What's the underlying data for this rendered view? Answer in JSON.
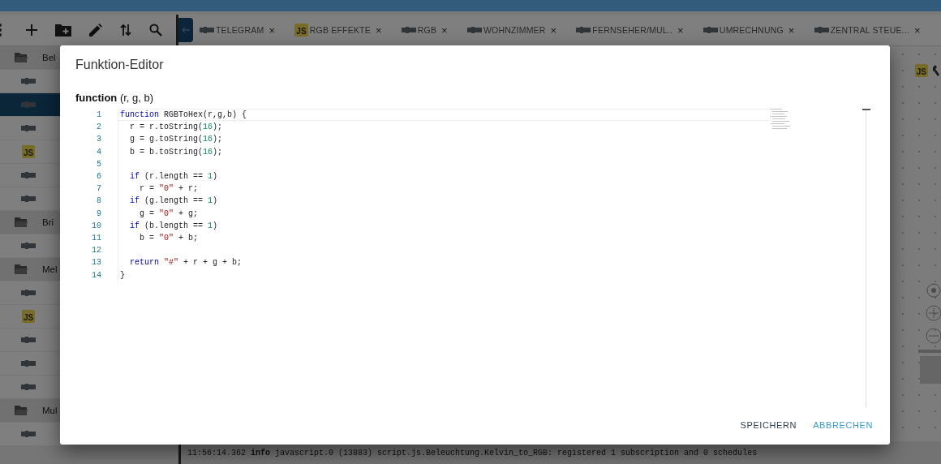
{
  "toolbar": {
    "buttons": [
      {
        "kind": "menu"
      },
      {
        "kind": "add"
      },
      {
        "kind": "new-folder"
      },
      {
        "kind": "edit"
      },
      {
        "kind": "sort"
      },
      {
        "kind": "search"
      }
    ]
  },
  "tabs": [
    {
      "kind": "script",
      "label": "TELEGRAM",
      "close": "×"
    },
    {
      "kind": "js",
      "badge": "JS",
      "label": "RGB EFFEKTE",
      "close": "×"
    },
    {
      "kind": "script",
      "label": "RGB",
      "close": "×"
    },
    {
      "kind": "script",
      "label": "WOHNZIMMER",
      "close": "×"
    },
    {
      "kind": "script",
      "label": "FERNSEHER/MUL..",
      "close": "×"
    },
    {
      "kind": "script",
      "label": "UMRECHNUNG",
      "close": "×"
    },
    {
      "kind": "script",
      "label": "ZENTRAL STEUE...",
      "close": "×"
    }
  ],
  "sidebar": {
    "items": [
      {
        "kind": "folder",
        "label": "Bel",
        "selected": false
      },
      {
        "kind": "script",
        "selected": false
      },
      {
        "kind": "script",
        "selected": true
      },
      {
        "kind": "script",
        "selected": false
      },
      {
        "kind": "js",
        "badge": "JS",
        "selected": false
      },
      {
        "kind": "script",
        "selected": false
      },
      {
        "kind": "script",
        "selected": false
      },
      {
        "kind": "folder",
        "label": "Bri",
        "selected": false
      },
      {
        "kind": "script",
        "selected": false
      },
      {
        "kind": "folder",
        "label": "Mel",
        "selected": false
      },
      {
        "kind": "script",
        "selected": false
      },
      {
        "kind": "js",
        "badge": "JS",
        "selected": false
      },
      {
        "kind": "script",
        "selected": false
      },
      {
        "kind": "script",
        "selected": false
      },
      {
        "kind": "script",
        "selected": false
      },
      {
        "kind": "folder",
        "label": "Mul",
        "selected": false
      },
      {
        "kind": "script",
        "selected": false
      }
    ]
  },
  "canvas": {
    "badge": "JS"
  },
  "log": {
    "time": "11:56:14.362",
    "level": "info",
    "message": "javascript.0 (13883) script.js.Beleuchtung.Kelvin_to_RGB: registered 1 subscription and 0 schedules"
  },
  "dialog": {
    "title": "Funktion-Editor",
    "signature": "**function** (r, g, b)",
    "lines": [
      {
        "number": "1",
        "tokens": [
          {
            "kind": "kw",
            "text": "function"
          },
          {
            "kind": "plain",
            "text": " RGBToHex(r,g,b) {"
          }
        ]
      },
      {
        "number": "2",
        "tokens": [
          {
            "kind": "plain",
            "text": "  r = r.toString("
          },
          {
            "kind": "num",
            "text": "16"
          },
          {
            "kind": "plain",
            "text": ");"
          }
        ]
      },
      {
        "number": "3",
        "tokens": [
          {
            "kind": "plain",
            "text": "  g = g.toString("
          },
          {
            "kind": "num",
            "text": "16"
          },
          {
            "kind": "plain",
            "text": ");"
          }
        ]
      },
      {
        "number": "4",
        "tokens": [
          {
            "kind": "plain",
            "text": "  b = b.toString("
          },
          {
            "kind": "num",
            "text": "16"
          },
          {
            "kind": "plain",
            "text": ");"
          }
        ]
      },
      {
        "number": "5"
      },
      {
        "number": "6",
        "tokens": [
          {
            "kind": "kw",
            "text": "  if"
          },
          {
            "kind": "plain",
            "text": " (r.length == "
          },
          {
            "kind": "num",
            "text": "1"
          },
          {
            "kind": "plain",
            "text": ")"
          }
        ]
      },
      {
        "number": "7",
        "tokens": [
          {
            "kind": "plain",
            "text": "    r = "
          },
          {
            "kind": "str",
            "text": "\"0\""
          },
          {
            "kind": "plain",
            "text": " + r;"
          }
        ]
      },
      {
        "number": "8",
        "tokens": [
          {
            "kind": "kw",
            "text": "  if"
          },
          {
            "kind": "plain",
            "text": " (g.length == "
          },
          {
            "kind": "num",
            "text": "1"
          },
          {
            "kind": "plain",
            "text": ")"
          }
        ]
      },
      {
        "number": "9",
        "tokens": [
          {
            "kind": "plain",
            "text": "    g = "
          },
          {
            "kind": "str",
            "text": "\"0\""
          },
          {
            "kind": "plain",
            "text": " + g;"
          }
        ]
      },
      {
        "number": "10",
        "tokens": [
          {
            "kind": "kw",
            "text": "  if"
          },
          {
            "kind": "plain",
            "text": " (b.length == "
          },
          {
            "kind": "num",
            "text": "1"
          },
          {
            "kind": "plain",
            "text": ")"
          }
        ]
      },
      {
        "number": "11",
        "tokens": [
          {
            "kind": "plain",
            "text": "    b = "
          },
          {
            "kind": "str",
            "text": "\"0\""
          },
          {
            "kind": "plain",
            "text": " + b;"
          }
        ]
      },
      {
        "number": "12"
      },
      {
        "number": "13",
        "tokens": [
          {
            "kind": "kw",
            "text": "  return"
          },
          {
            "kind": "str",
            "text": " \"#\""
          },
          {
            "kind": "plain",
            "text": " + r + g + b;"
          }
        ]
      },
      {
        "number": "14",
        "tokens": [
          {
            "kind": "plain",
            "text": "}"
          }
        ]
      }
    ],
    "buttons": [
      {
        "kind": "save",
        "label": "SPEICHERN"
      },
      {
        "kind": "cancel",
        "label": "ABBRECHEN"
      }
    ]
  }
}
